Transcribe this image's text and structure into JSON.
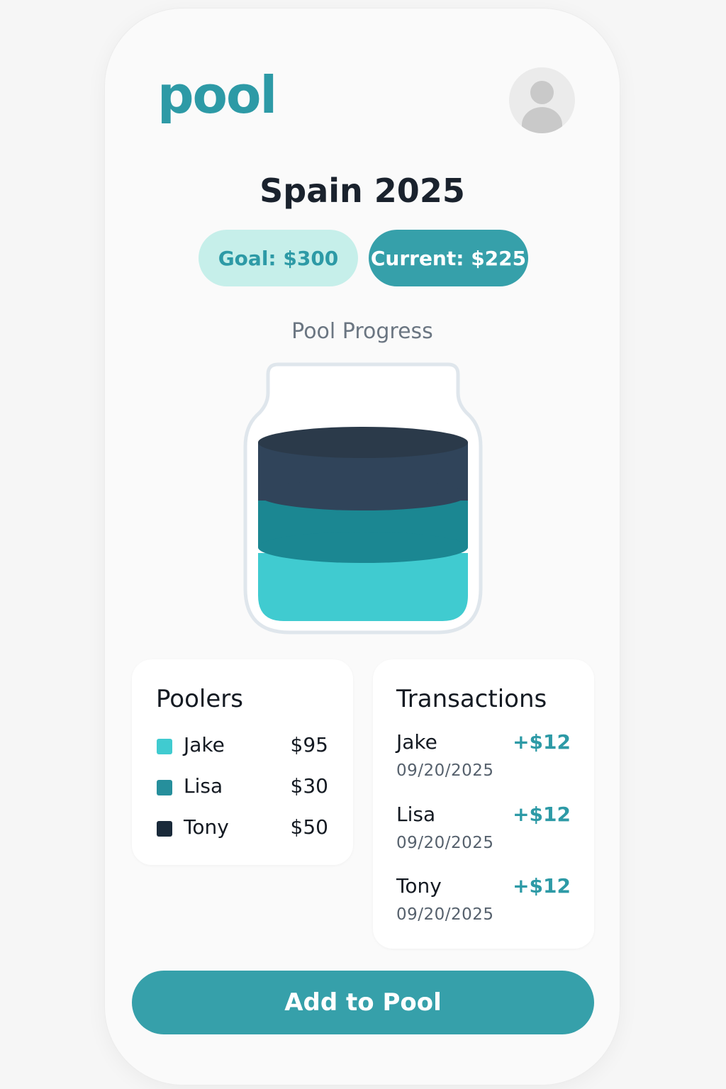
{
  "app": {
    "logo_text": "pool"
  },
  "header": {
    "avatar_icon": "user-avatar-icon"
  },
  "pool": {
    "title": "Spain 2025",
    "goal_label": "Goal: $300",
    "current_label": "Current: $225",
    "progress_label": "Pool Progress",
    "goal_amount": 300,
    "current_amount": 225
  },
  "colors": {
    "accent": "#36a0aa",
    "brand": "#2d9aa6",
    "goal_pill_bg": "#c6efea",
    "jake": "#40cbd0",
    "lisa": "#1b8792",
    "tony": "#30445a"
  },
  "poolers": {
    "title": "Poolers",
    "items": [
      {
        "name": "Jake",
        "amount": "$95",
        "value": 95,
        "color": "#40cbd0"
      },
      {
        "name": "Lisa",
        "amount": "$30",
        "value": 30,
        "color": "#268f9c"
      },
      {
        "name": "Tony",
        "amount": "$50",
        "value": 50,
        "color": "#1a2a3a"
      }
    ]
  },
  "transactions": {
    "title": "Transactions",
    "items": [
      {
        "name": "Jake",
        "amount": "+$12",
        "date": "09/20/2025"
      },
      {
        "name": "Lisa",
        "amount": "+$12",
        "date": "09/20/2025"
      },
      {
        "name": "Tony",
        "amount": "+$12",
        "date": "09/20/2025"
      }
    ]
  },
  "actions": {
    "add_label": "Add to Pool"
  }
}
